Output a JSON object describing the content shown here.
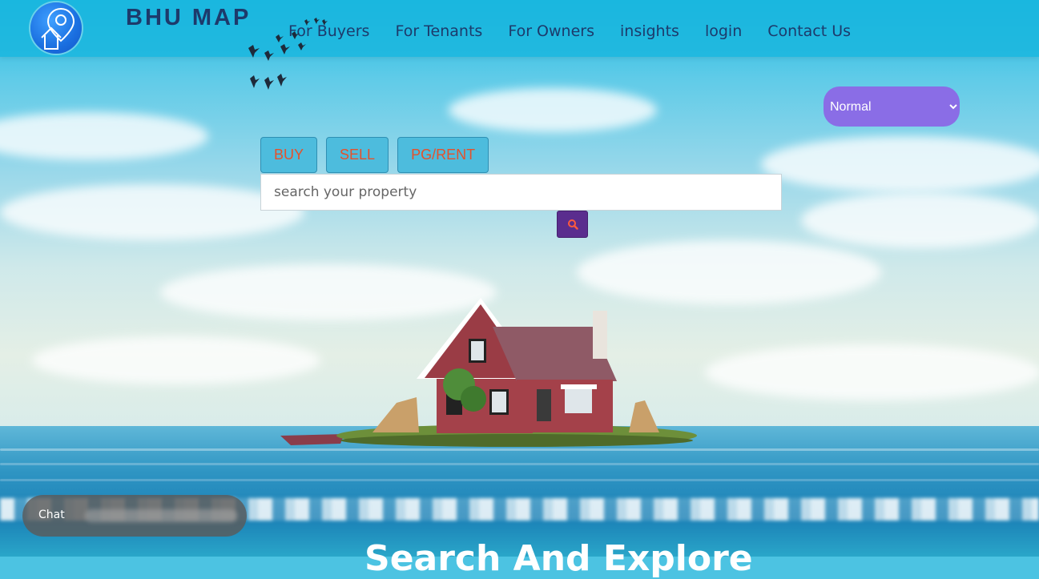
{
  "brand": {
    "name": "BHU MAP"
  },
  "nav": {
    "items": [
      {
        "label": "For Buyers"
      },
      {
        "label": "For Tenants"
      },
      {
        "label": "For Owners"
      },
      {
        "label": "insights"
      },
      {
        "label": "login"
      },
      {
        "label": "Contact Us"
      }
    ]
  },
  "mode_select": {
    "selected": "Normal"
  },
  "search": {
    "tabs": [
      {
        "label": "BUY"
      },
      {
        "label": "SELL"
      },
      {
        "label": "PG/RENT"
      }
    ],
    "placeholder": "search your property",
    "button_icon": "search-icon"
  },
  "chat": {
    "label": "Chat"
  },
  "hero": {
    "heading": "Search And Explore"
  },
  "colors": {
    "header_bg": "#1ab6de",
    "brand_text": "#1d3a6b",
    "tab_bg": "#4dbcdd",
    "tab_text": "#e5512b",
    "search_button": "#5a2d8e",
    "mode_select_bg": "#8a6de6"
  }
}
